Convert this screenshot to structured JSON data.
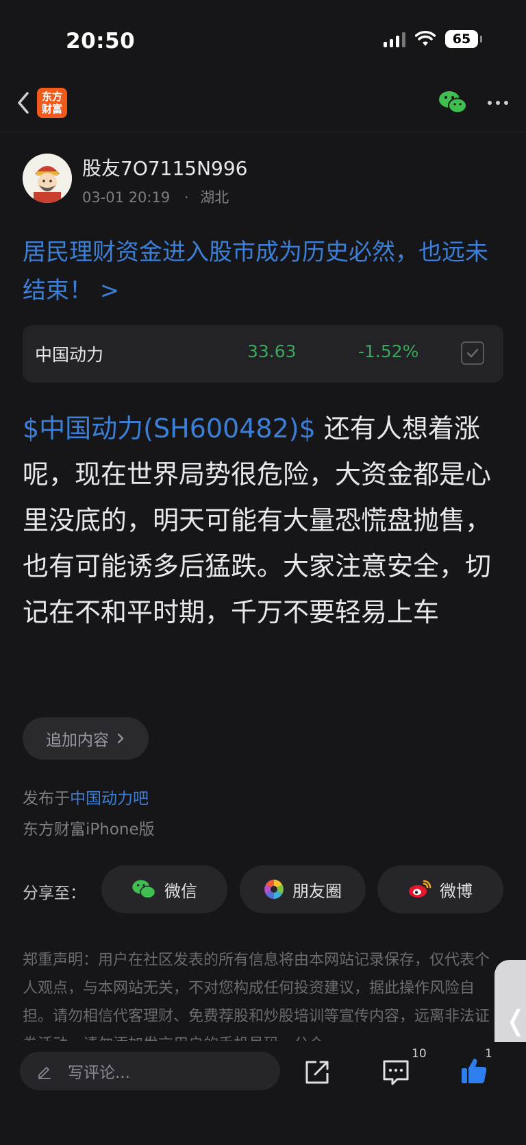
{
  "status_bar": {
    "time": "20:50",
    "battery": "65"
  },
  "nav": {
    "app_logo_line1": "东方",
    "app_logo_line2": "财富"
  },
  "author": {
    "name": "股友7O7115N996",
    "datetime": "03-01 20:19",
    "location": "湖北",
    "separator": "·"
  },
  "post": {
    "title": "居民理财资金进入股市成为历史必然，也远未结束！ >",
    "stock": {
      "name": "中国动力",
      "price": "33.63",
      "change": "-1.52%"
    },
    "body_link": "$中国动力(SH600482)$",
    "body_text": " 还有人想着涨呢，现在世界局势很危险，大资金都是心里没底的，明天可能有大量恐慌盘抛售，也有可能诱多后猛跌。大家注意安全，切记在不和平时期，千万不要轻易上车",
    "add_content_label": "追加内容",
    "published_prefix": "发布于",
    "published_bar": "中国动力吧",
    "client": "东方财富iPhone版"
  },
  "share": {
    "label": "分享至：",
    "wechat": "微信",
    "moments": "朋友圈",
    "weibo": "微博"
  },
  "disclaimer": "郑重声明：用户在社区发表的所有信息将由本网站记录保存，仅代表个人观点，与本网站无关，不对您构成任何投资建议，据此操作风险自担。请勿相信代客理财、免费荐股和炒股培训等宣传内容，远离非法证券活动。请勿添加发言用户的手机号码、公众",
  "bottom_bar": {
    "comment_placeholder": "写评论...",
    "comment_count": "10",
    "like_count": "1"
  },
  "colors": {
    "link": "#3c7fd6",
    "down": "#3aa85b",
    "background": "#161619"
  }
}
